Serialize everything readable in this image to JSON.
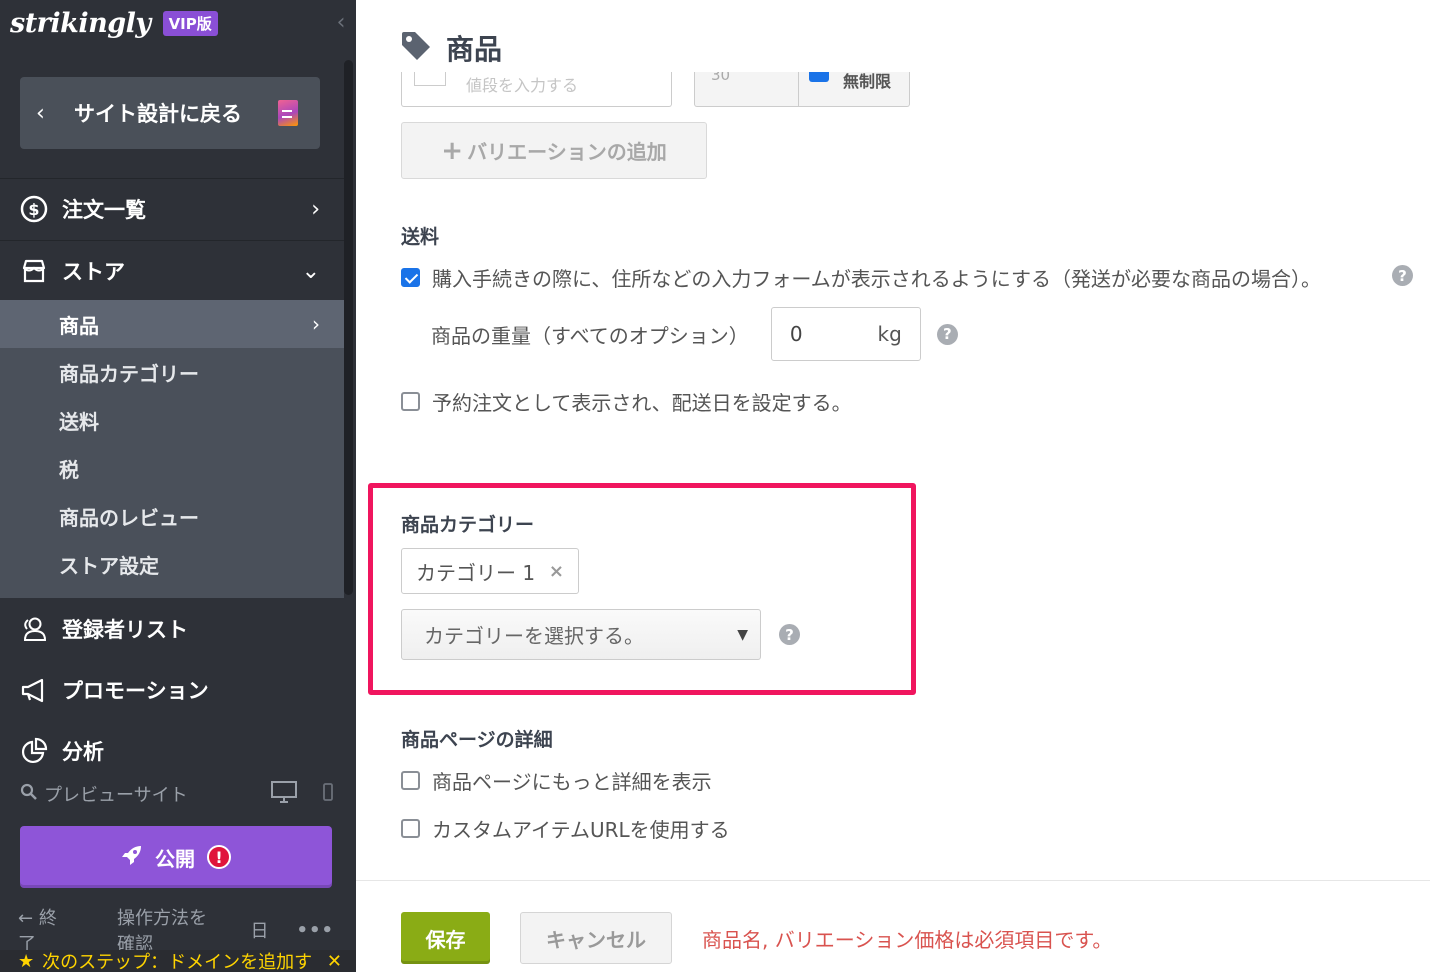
{
  "sidebar": {
    "logo": "strikingly",
    "badge": "VIP版",
    "back_label": "サイト設計に戻る",
    "nav": {
      "orders": "注文一覧",
      "store": "ストア",
      "subscribers": "登録者リスト",
      "promotion": "プロモーション",
      "analytics": "分析"
    },
    "store_sub": [
      "商品",
      "商品カテゴリー",
      "送料",
      "税",
      "商品のレビュー",
      "ストア設定"
    ],
    "preview_label": "プレビューサイト",
    "publish_label": "公開",
    "publish_alert": "!",
    "footer": {
      "exit": "終了",
      "howto": "操作方法を確認",
      "lang": "日",
      "more": "•••"
    },
    "next_step": "次のステップ：ドメインを追加す"
  },
  "main": {
    "title": "商品",
    "price_placeholder": "値段を入力する",
    "stock_value": "30",
    "unlimited_label": "無制限",
    "add_variation": "バリエーションの追加",
    "shipping": {
      "heading": "送料",
      "require_address": "購入手続きの際に、住所などの入力フォームが表示されるようにする（発送が必要な商品の場合）。",
      "require_address_checked": true,
      "weight_label": "商品の重量（すべてのオプション）",
      "weight_value": "0",
      "weight_unit": "kg",
      "preorder": "予約注文として表示され、配送日を設定する。",
      "preorder_checked": false
    },
    "category": {
      "heading": "商品カテゴリー",
      "selected_chip": "カテゴリー 1",
      "chip_remove": "×",
      "select_placeholder": "カテゴリーを選択する。"
    },
    "details": {
      "heading": "商品ページの詳細",
      "show_more": "商品ページにもっと詳細を表示",
      "custom_url": "カスタムアイテムURLを使用する"
    },
    "save_label": "保存",
    "cancel_label": "キャンセル",
    "error_message": "商品名, バリエーション価格は必須項目です。"
  },
  "colors": {
    "sidebar_bg": "#2e3138",
    "publish": "#8e55d8",
    "save": "#8aac15",
    "highlight": "#f0155e",
    "error": "#d9534f",
    "checkbox": "#1a73e8"
  }
}
